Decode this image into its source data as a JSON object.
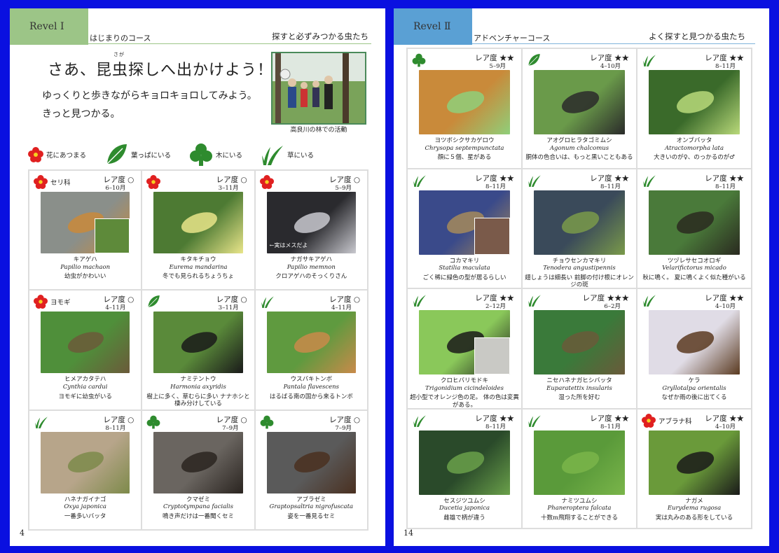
{
  "left": {
    "level": "Revel Ⅰ",
    "course": "はじまりのコース",
    "subtitle": "探すと必ずみつかる虫たち",
    "heading": "さあ、昆虫探しへ出かけよう！",
    "heading_ruby": "さが",
    "intro1": "ゆっくりと歩きながらキョロキョロしてみよう。",
    "intro2": "きっと見つかる。",
    "photo_caption": "高良川の林での活動",
    "legend": [
      {
        "icon": "flower-icon",
        "label": "花にあつまる"
      },
      {
        "icon": "leaf-icon",
        "label": "葉っぱにいる"
      },
      {
        "icon": "tree-icon",
        "label": "木にいる"
      },
      {
        "icon": "grass-icon",
        "label": "草にいる"
      }
    ],
    "cards": [
      {
        "icon": "flower-icon",
        "family": "セリ科",
        "rarity": "レア度 ○",
        "months": "6–10月",
        "name": "キアゲハ",
        "sci": "Papilio machaon",
        "desc": "幼虫がかわいい",
        "c1": "#8a8f8a",
        "c2": "#c98a3a",
        "inset_color": "#5e8a3a"
      },
      {
        "icon": "flower-icon",
        "family": "",
        "rarity": "レア度 ○",
        "months": "3–11月",
        "name": "キタキチョウ",
        "sci": "Eurema mandarina",
        "desc": "冬でも見られるちょうちょ",
        "c1": "#4d7a33",
        "c2": "#e9e58a"
      },
      {
        "icon": "flower-icon",
        "family": "",
        "rarity": "レア度 ○",
        "months": "5–9月",
        "name": "ナガサキアゲハ",
        "sci": "Papilio memnon",
        "desc": "クロアゲハのそっくりさん",
        "c1": "#2a2a2e",
        "c2": "#c9c9cf",
        "photo_label": "←実はメスだよ"
      },
      {
        "icon": "flower-icon",
        "family": "ヨモギ",
        "rarity": "レア度 ○",
        "months": "4–11月",
        "name": "ヒメアカタテハ",
        "sci": "Cynthia cardui",
        "desc": "ヨモギに幼虫がいる",
        "c1": "#4f8f3a",
        "c2": "#6b5a3a"
      },
      {
        "icon": "leaf-icon",
        "family": "",
        "rarity": "レア度 ○",
        "months": "3–11月",
        "name": "ナミテントウ",
        "sci": "Harmonia axyridis",
        "desc": "樹上に多く、草むらに多い ナナホシと棲み分けしている",
        "c1": "#5a8a3a",
        "c2": "#1a1a1a"
      },
      {
        "icon": "grass-icon",
        "family": "",
        "rarity": "レア度 ○",
        "months": "4–11月",
        "name": "ウスバキトンボ",
        "sci": "Pantala flavescens",
        "desc": "はるばる南の国から来るトンボ",
        "c1": "#5f9a3f",
        "c2": "#c98a4a"
      },
      {
        "icon": "grass-icon",
        "family": "",
        "rarity": "レア度 ○",
        "months": "8–11月",
        "name": "ハネナガイナゴ",
        "sci": "Oxya japonica",
        "desc": "一番多いバッタ",
        "c1": "#b7a58a",
        "c2": "#7d8a4a"
      },
      {
        "icon": "tree-icon",
        "family": "",
        "rarity": "レア度 ○",
        "months": "7–9月",
        "name": "クマゼミ",
        "sci": "Cryptotympana facialis",
        "desc": "鳴き声だけは一番聞くセミ",
        "c1": "#6a6560",
        "c2": "#2a2420"
      },
      {
        "icon": "tree-icon",
        "family": "",
        "rarity": "レア度 ○",
        "months": "7–9月",
        "name": "アブラゼミ",
        "sci": "Graptopsaltria nigrofuscata",
        "desc": "姿を一番見るセミ",
        "c1": "#5a5a5a",
        "c2": "#4a3020"
      }
    ],
    "page_number": "4"
  },
  "right": {
    "level": "Revel Ⅱ",
    "course": "アドベンチャーコース",
    "subtitle": "よく探すと見つかる虫たち",
    "cards": [
      {
        "icon": "tree-icon",
        "family": "",
        "rarity": "レア度 ★★",
        "months": "5–9月",
        "name": "ヨツボシクサカゲロウ",
        "sci": "Chrysopa septempunctata",
        "desc": "顔に５個、星がある",
        "c1": "#c98a3a",
        "c2": "#8fcf7a"
      },
      {
        "icon": "leaf-icon",
        "family": "",
        "rarity": "レア度 ★★",
        "months": "4–10月",
        "name": "アオグロヒラタゴミムシ",
        "sci": "Agonum chalcomus",
        "desc": "胴体の色合いは、もっと黒いこともある",
        "c1": "#6a9a4a",
        "c2": "#2a2a2a"
      },
      {
        "icon": "grass-icon",
        "family": "",
        "rarity": "レア度 ★★",
        "months": "8–11月",
        "name": "オンブバッタ",
        "sci": "Atractomorpha lata",
        "desc": "大きいのが♀、のっかるのが♂",
        "c1": "#3a6a2a",
        "c2": "#b9d97a"
      },
      {
        "icon": "grass-icon",
        "family": "",
        "rarity": "レア度 ★★",
        "months": "8–11月",
        "name": "コカマキリ",
        "sci": "Statilia maculata",
        "desc": "ごく稀に緑色の型が居るらしい",
        "c1": "#3a4a8a",
        "c2": "#a68a5a",
        "inset_color": "#7a5a4a"
      },
      {
        "icon": "grass-icon",
        "family": "",
        "rarity": "レア度 ★★",
        "months": "8–11月",
        "name": "チョウセンカマキリ",
        "sci": "Tenodera angustipennis",
        "desc": "翅しょうは細長い 前脚の付け根にオレンジの斑",
        "c1": "#3a4a5a",
        "c2": "#7a9a4a"
      },
      {
        "icon": "grass-icon",
        "family": "",
        "rarity": "レア度 ★★",
        "months": "8–11月",
        "name": "ツヅレサセコオロギ",
        "sci": "Velarifictorus micado",
        "desc": "秋に鳴く。 夏に鳴くよく似た種がいる",
        "c1": "#4a7a3a",
        "c2": "#2a2a20"
      },
      {
        "icon": "grass-icon",
        "family": "",
        "rarity": "レア度 ★★",
        "months": "2–12月",
        "name": "クロヒバリモドキ",
        "sci": "Trigonidium cicindeloides",
        "desc": "超小型でオレンジ色の足。 体の色は変異がある。",
        "c1": "#8ac85a",
        "c2": "#1a1a1a",
        "inset_color": "#c9c9c5"
      },
      {
        "icon": "grass-icon",
        "family": "",
        "rarity": "レア度 ★★★",
        "months": "6–2月",
        "name": "ニセハネナガヒシバッタ",
        "sci": "Euparatettix insularis",
        "desc": "湿った所を好む",
        "c1": "#3a7a3a",
        "c2": "#6a5a3a"
      },
      {
        "icon": "grass-icon",
        "family": "",
        "rarity": "レア度 ★★",
        "months": "4–10月",
        "name": "ケラ",
        "sci": "Gryllotalpa orientalis",
        "desc": "なぜか雨の後に出てくる",
        "c1": "#e0dce6",
        "c2": "#5a3a20"
      },
      {
        "icon": "grass-icon",
        "family": "",
        "rarity": "レア度 ★★",
        "months": "8–11月",
        "name": "セスジツユムシ",
        "sci": "Ducetia japonica",
        "desc": "雌雄で柄が違う",
        "c1": "#2a4a2a",
        "c2": "#6aa04a"
      },
      {
        "icon": "grass-icon",
        "family": "",
        "rarity": "レア度 ★★",
        "months": "8–11月",
        "name": "ナミツユムシ",
        "sci": "Phaneroptera falcata",
        "desc": "十数m飛翔することができる",
        "c1": "#5a9a3a",
        "c2": "#7ab54a"
      },
      {
        "icon": "flower-icon",
        "family": "アブラナ科",
        "rarity": "レア度 ★★",
        "months": "4–10月",
        "name": "ナガメ",
        "sci": "Eurydema rugosa",
        "desc": "実は丸みのある形をしている",
        "c1": "#6a9a3a",
        "c2": "#1a1a1a"
      }
    ],
    "page_number": "14"
  },
  "colors": {
    "background": "#0a10e0",
    "level1_tab": "#9cc587",
    "level2_tab": "#5aa0d4"
  }
}
